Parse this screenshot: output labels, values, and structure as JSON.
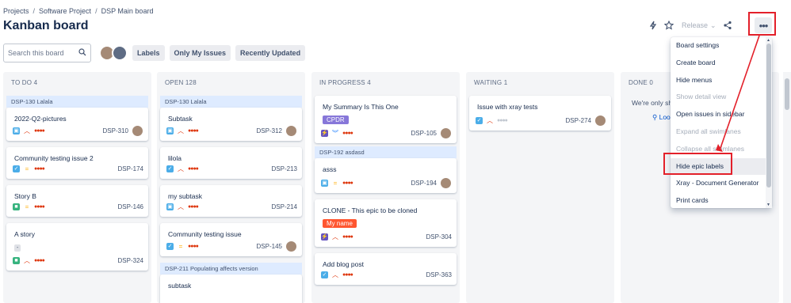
{
  "breadcrumb": {
    "items": [
      "Projects",
      "Software Project",
      "DSP Main board"
    ],
    "sep": "/"
  },
  "page_title": "Kanban board",
  "header": {
    "release_label": "Release",
    "more_label": "•••"
  },
  "toolbar": {
    "search_placeholder": "Search this board",
    "filters": [
      "Labels",
      "Only My Issues",
      "Recently Updated"
    ]
  },
  "columns": [
    {
      "title": "TO DO 4",
      "epic": "DSP-130 Lalala",
      "cards": [
        {
          "title": "2022-Q2-pictures",
          "key": "DSP-310"
        },
        {
          "title": "Community testing issue 2",
          "key": "DSP-174"
        },
        {
          "title": "Story B",
          "key": "DSP-146"
        },
        {
          "title": "A story",
          "chip": "-",
          "key": "DSP-324"
        }
      ]
    },
    {
      "title": "OPEN 128",
      "epic": "DSP-130 Lalala",
      "epic2": "DSP-211 Populating affects version",
      "cards": [
        {
          "title": "Subtask",
          "key": "DSP-312"
        },
        {
          "title": "lilola",
          "key": "DSP-213"
        },
        {
          "title": "my subtask",
          "key": "DSP-214"
        },
        {
          "title": "Community testing issue",
          "key": "DSP-145"
        },
        {
          "title": "subtask",
          "key": ""
        }
      ]
    },
    {
      "title": "IN PROGRESS 4",
      "epic": "DSP-192 asdasd",
      "cards": [
        {
          "title": "My Summary Is This One",
          "chip": "CPDR",
          "key": "DSP-105"
        },
        {
          "title": "asss",
          "key": "DSP-194"
        },
        {
          "title": "CLONE - This epic to be cloned",
          "chip": "My name",
          "key": "DSP-304"
        },
        {
          "title": "Add blog post",
          "key": "DSP-363"
        }
      ]
    },
    {
      "title": "WAITING 1",
      "cards": [
        {
          "title": "Issue with xray tests",
          "key": "DSP-274"
        }
      ]
    },
    {
      "title": "DONE 0",
      "empty_text": "We're only sho",
      "link_text": "Loo"
    }
  ],
  "menu": {
    "items": [
      {
        "label": "Board settings",
        "state": "normal"
      },
      {
        "label": "Create board",
        "state": "normal"
      },
      {
        "label": "Hide menus",
        "state": "normal"
      },
      {
        "label": "Show detail view",
        "state": "disabled"
      },
      {
        "label": "Open issues in sidebar",
        "state": "normal"
      },
      {
        "label": "Expand all swimlanes",
        "state": "disabled"
      },
      {
        "label": "Collapse all swimlanes",
        "state": "disabled"
      },
      {
        "label": "Hide epic labels",
        "state": "active"
      },
      {
        "label": "Xray - Document Generator",
        "state": "normal"
      },
      {
        "label": "Print cards",
        "state": "normal"
      }
    ]
  },
  "colors": {
    "annotation": "#e3202a",
    "epic_bg": "#deebff",
    "column_bg": "#f4f5f7"
  }
}
